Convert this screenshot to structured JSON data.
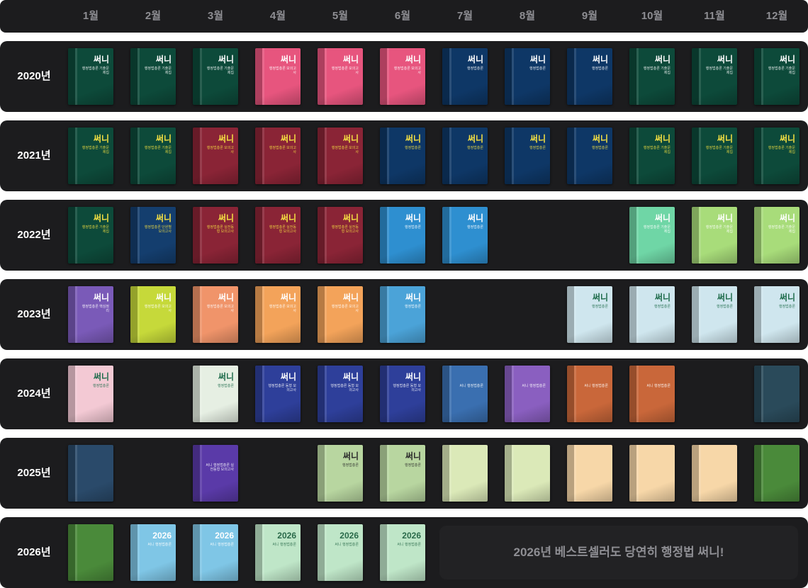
{
  "months": [
    "1월",
    "2월",
    "3월",
    "4월",
    "5월",
    "6월",
    "7월",
    "8월",
    "9월",
    "10월",
    "11월",
    "12월"
  ],
  "years": [
    {
      "label": "2020년",
      "books": [
        {
          "m": 1,
          "title": "써니",
          "sub": "행정법총론 기출문제집",
          "bg": "#0d4a3a",
          "fg": "#ffffff"
        },
        {
          "m": 2,
          "title": "써니",
          "sub": "행정법총론 기출문제집",
          "bg": "#0d4a3a",
          "fg": "#ffffff"
        },
        {
          "m": 3,
          "title": "써니",
          "sub": "행정법총론 기출문제집",
          "bg": "#0d4a3a",
          "fg": "#ffffff"
        },
        {
          "m": 4,
          "title": "써니",
          "sub": "행정법총론 모의고사",
          "bg": "#e7557e",
          "fg": "#ffffff"
        },
        {
          "m": 5,
          "title": "써니",
          "sub": "행정법총론 모의고사",
          "bg": "#e7557e",
          "fg": "#ffffff"
        },
        {
          "m": 6,
          "title": "써니",
          "sub": "행정법총론 모의고사",
          "bg": "#e7557e",
          "fg": "#ffffff"
        },
        {
          "m": 7,
          "title": "써니",
          "sub": "행정법총론",
          "bg": "#0e3766",
          "fg": "#ffffff"
        },
        {
          "m": 8,
          "title": "써니",
          "sub": "행정법총론",
          "bg": "#0e3766",
          "fg": "#ffffff"
        },
        {
          "m": 9,
          "title": "써니",
          "sub": "행정법총론",
          "bg": "#0e3766",
          "fg": "#ffffff"
        },
        {
          "m": 10,
          "title": "써니",
          "sub": "행정법총론 기출문제집",
          "bg": "#0d4a3a",
          "fg": "#ffffff"
        },
        {
          "m": 11,
          "title": "써니",
          "sub": "행정법총론 기출문제집",
          "bg": "#0d4a3a",
          "fg": "#ffffff"
        },
        {
          "m": 12,
          "title": "써니",
          "sub": "행정법총론 기출문제집",
          "bg": "#0d4a3a",
          "fg": "#ffffff"
        }
      ]
    },
    {
      "label": "2021년",
      "books": [
        {
          "m": 1,
          "title": "써니",
          "sub": "행정법총론 기출문제집",
          "bg": "#0d4a3a",
          "fg": "#f5e042"
        },
        {
          "m": 2,
          "title": "써니",
          "sub": "행정법총론 기출문제집",
          "bg": "#0d4a3a",
          "fg": "#f5e042"
        },
        {
          "m": 3,
          "title": "써니",
          "sub": "행정법총론 모의고사",
          "bg": "#8a2436",
          "fg": "#f5e042"
        },
        {
          "m": 4,
          "title": "써니",
          "sub": "행정법총론 모의고사",
          "bg": "#8a2436",
          "fg": "#f5e042"
        },
        {
          "m": 5,
          "title": "써니",
          "sub": "행정법총론 모의고사",
          "bg": "#8a2436",
          "fg": "#f5e042"
        },
        {
          "m": 6,
          "title": "써니",
          "sub": "행정법총론",
          "bg": "#0e3766",
          "fg": "#f5e042"
        },
        {
          "m": 7,
          "title": "써니",
          "sub": "행정법총론",
          "bg": "#0e3766",
          "fg": "#f5e042"
        },
        {
          "m": 8,
          "title": "써니",
          "sub": "행정법총론",
          "bg": "#0e3766",
          "fg": "#f5e042"
        },
        {
          "m": 9,
          "title": "써니",
          "sub": "행정법총론",
          "bg": "#0e3766",
          "fg": "#f5e042"
        },
        {
          "m": 10,
          "title": "써니",
          "sub": "행정법총론 기출문제집",
          "bg": "#0d4a3a",
          "fg": "#f5e042"
        },
        {
          "m": 11,
          "title": "써니",
          "sub": "행정법총론 기출문제집",
          "bg": "#0d4a3a",
          "fg": "#f5e042"
        },
        {
          "m": 12,
          "title": "써니",
          "sub": "행정법총론 기출문제집",
          "bg": "#0d4a3a",
          "fg": "#f5e042"
        }
      ]
    },
    {
      "label": "2022년",
      "books": [
        {
          "m": 1,
          "title": "써니",
          "sub": "행정법총론 기출문제집",
          "bg": "#0d4a3a",
          "fg": "#f5e042"
        },
        {
          "m": 2,
          "title": "써니",
          "sub": "행정법총론 단원별 모의고사",
          "bg": "#143e6e",
          "fg": "#f5e042"
        },
        {
          "m": 3,
          "title": "써니",
          "sub": "행정법총론 실전동형 모의고사",
          "bg": "#8a2436",
          "fg": "#f5e042"
        },
        {
          "m": 4,
          "title": "써니",
          "sub": "행정법총론 실전동형 모의고사",
          "bg": "#8a2436",
          "fg": "#f5e042"
        },
        {
          "m": 5,
          "title": "써니",
          "sub": "행정법총론 실전동형 모의고사",
          "bg": "#8a2436",
          "fg": "#f5e042"
        },
        {
          "m": 6,
          "title": "써니",
          "sub": "행정법총론",
          "bg": "#2e8fd0",
          "fg": "#ffffff"
        },
        {
          "m": 7,
          "title": "써니",
          "sub": "행정법총론",
          "bg": "#2e8fd0",
          "fg": "#ffffff"
        },
        {
          "m": 10,
          "title": "써니",
          "sub": "행정법총론 기출문제집",
          "bg": "#6fd6a6",
          "fg": "#ffffff"
        },
        {
          "m": 11,
          "title": "써니",
          "sub": "행정법총론 기출문제집",
          "bg": "#a8dc7a",
          "fg": "#ffffff"
        },
        {
          "m": 12,
          "title": "써니",
          "sub": "행정법총론 기출문제집",
          "bg": "#a8dc7a",
          "fg": "#ffffff"
        }
      ]
    },
    {
      "label": "2023년",
      "books": [
        {
          "m": 1,
          "title": "써니",
          "sub": "행정법총론 핵심정리",
          "bg": "#7a5ab8",
          "fg": "#ffffff"
        },
        {
          "m": 2,
          "title": "써니",
          "sub": "행정법총론 모의고사",
          "bg": "#c6d93a",
          "fg": "#ffffff"
        },
        {
          "m": 3,
          "title": "써니",
          "sub": "행정법총론 모의고사",
          "bg": "#f0946a",
          "fg": "#ffffff"
        },
        {
          "m": 4,
          "title": "써니",
          "sub": "행정법총론 모의고사",
          "bg": "#f3a35a",
          "fg": "#ffffff"
        },
        {
          "m": 5,
          "title": "써니",
          "sub": "행정법총론 모의고사",
          "bg": "#f3a35a",
          "fg": "#ffffff"
        },
        {
          "m": 6,
          "title": "써니",
          "sub": "행정법총론",
          "bg": "#4ba3d8",
          "fg": "#ffffff"
        },
        {
          "m": 9,
          "title": "써니",
          "sub": "행정법총론",
          "bg": "#cfe6ee",
          "fg": "#1d6b4a"
        },
        {
          "m": 10,
          "title": "써니",
          "sub": "행정법총론",
          "bg": "#cfe6ee",
          "fg": "#1d6b4a"
        },
        {
          "m": 11,
          "title": "써니",
          "sub": "행정법총론",
          "bg": "#cfe6ee",
          "fg": "#1d6b4a"
        },
        {
          "m": 12,
          "title": "써니",
          "sub": "행정법총론",
          "bg": "#cfe6ee",
          "fg": "#1d6b4a"
        }
      ]
    },
    {
      "label": "2024년",
      "books": [
        {
          "m": 1,
          "title": "써니",
          "sub": "행정법총론",
          "bg": "#f3c9d4",
          "fg": "#1d6b4a"
        },
        {
          "m": 3,
          "title": "써니",
          "sub": "행정법총론",
          "bg": "#e6efe3",
          "fg": "#1d6b4a"
        },
        {
          "m": 4,
          "title": "써니",
          "sub": "행정법총론 동형 모의고사",
          "bg": "#2e3f9a",
          "fg": "#ffffff"
        },
        {
          "m": 5,
          "title": "써니",
          "sub": "행정법총론 동형 모의고사",
          "bg": "#2e3f9a",
          "fg": "#ffffff"
        },
        {
          "m": 6,
          "title": "써니",
          "sub": "행정법총론 동형 모의고사",
          "bg": "#2e3f9a",
          "fg": "#ffffff"
        },
        {
          "m": 7,
          "title": "",
          "sub": "써니 행정법총론",
          "bg": "#3a6fb0",
          "fg": "#ffffff"
        },
        {
          "m": 8,
          "title": "",
          "sub": "써니 행정법총론",
          "bg": "#8a5fc0",
          "fg": "#ffffff"
        },
        {
          "m": 9,
          "title": "",
          "sub": "써니 행정법총론",
          "bg": "#c9673a",
          "fg": "#ffffff"
        },
        {
          "m": 10,
          "title": "",
          "sub": "써니 행정법총론",
          "bg": "#c9673a",
          "fg": "#ffffff"
        },
        {
          "m": 12,
          "title": "",
          "sub": "",
          "bg": "#2a4a5a",
          "fg": "#ffffff"
        }
      ]
    },
    {
      "label": "2025년",
      "books": [
        {
          "m": 1,
          "title": "",
          "sub": "",
          "bg": "#2a4a6a",
          "fg": "#ffffff"
        },
        {
          "m": 3,
          "title": "",
          "sub": "써니 행정법총론 실전동형 모의고사",
          "bg": "#5a3aa8",
          "fg": "#ffffff"
        },
        {
          "m": 5,
          "title": "써니",
          "sub": "행정법총론",
          "bg": "#b8d6a0",
          "fg": "#2a2a2a"
        },
        {
          "m": 6,
          "title": "써니",
          "sub": "행정법총론",
          "bg": "#b8d6a0",
          "fg": "#2a2a2a"
        },
        {
          "m": 7,
          "title": "",
          "sub": "",
          "bg": "#dbe9b8",
          "fg": "#2a2a2a"
        },
        {
          "m": 8,
          "title": "",
          "sub": "",
          "bg": "#dbe9b8",
          "fg": "#2a2a2a"
        },
        {
          "m": 9,
          "title": "",
          "sub": "",
          "bg": "#f7d7a8",
          "fg": "#2a2a2a"
        },
        {
          "m": 10,
          "title": "",
          "sub": "",
          "bg": "#f7d7a8",
          "fg": "#2a2a2a"
        },
        {
          "m": 11,
          "title": "",
          "sub": "",
          "bg": "#f7d7a8",
          "fg": "#2a2a2a"
        },
        {
          "m": 12,
          "title": "",
          "sub": "",
          "bg": "#4a8a3a",
          "fg": "#ffffff"
        }
      ]
    },
    {
      "label": "2026년",
      "books": [
        {
          "m": 1,
          "title": "",
          "sub": "",
          "bg": "#4a8a3a",
          "fg": "#ffffff"
        },
        {
          "m": 2,
          "title": "2026",
          "sub": "써니 행정법총론",
          "bg": "#7fc6e6",
          "fg": "#ffffff"
        },
        {
          "m": 3,
          "title": "2026",
          "sub": "써니 행정법총론",
          "bg": "#7fc6e6",
          "fg": "#ffffff"
        },
        {
          "m": 4,
          "title": "2026",
          "sub": "써니 행정법총론",
          "bg": "#bfe6c8",
          "fg": "#2a6a4a"
        },
        {
          "m": 5,
          "title": "2026",
          "sub": "써니 행정법총론",
          "bg": "#bfe6c8",
          "fg": "#2a6a4a"
        },
        {
          "m": 6,
          "title": "2026",
          "sub": "써니 행정법총론",
          "bg": "#bfe6c8",
          "fg": "#2a6a4a"
        }
      ]
    }
  ],
  "note": "2026년 베스트셀러도 당연히 행정법 써니!"
}
